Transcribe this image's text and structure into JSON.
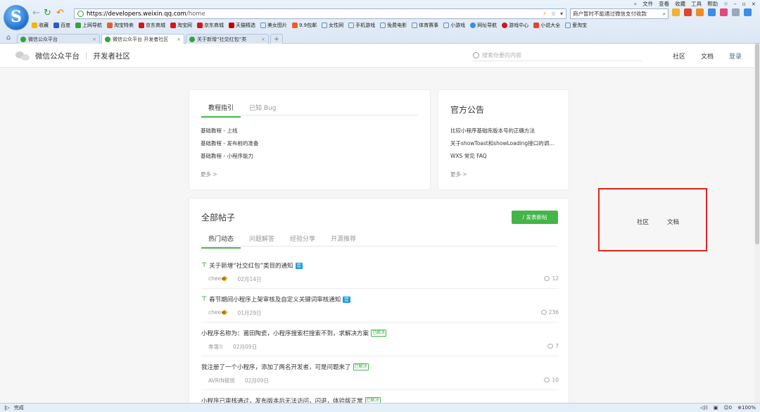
{
  "browser": {
    "menubar": [
      "文件",
      "查看",
      "收藏",
      "工具",
      "帮助"
    ],
    "logo_letter": "S",
    "url_domain": "https://developers.weixin.qq.com",
    "url_path": "/home",
    "search_hint": "商户暂时不能通过微信支付收款",
    "favorites": [
      "收藏",
      "百度",
      "上网导航",
      "淘宝特卖",
      "京东商城",
      "淘宝网",
      "京东商城",
      "天猫精选",
      "美女图片",
      "9.9包邮",
      "女性网",
      "手机游戏",
      "免费电影",
      "体育赛事",
      "小游戏",
      "网址导航",
      "游戏中心",
      "小说大全",
      "爱淘宝"
    ],
    "tabs": [
      {
        "label": "微信公众平台",
        "active": false
      },
      {
        "label": "微信公众平台 开发者社区",
        "active": true
      },
      {
        "label": "关于新增“社交红包”类",
        "active": false
      }
    ],
    "status_text": "完成",
    "zoom": "100%",
    "status_count": "0"
  },
  "header": {
    "brand": "微信公众平台",
    "sub": "开发者社区",
    "search_placeholder": "搜索你要的内容",
    "nav": [
      "社区",
      "文档",
      "登录"
    ]
  },
  "tutorial": {
    "tabs": [
      "教程指引",
      "已知 Bug"
    ],
    "items": [
      "基础教程 - 上线",
      "基础教程 - 发布前的准备",
      "基础教程 - 小程序能力"
    ],
    "more": "更多 >"
  },
  "announce": {
    "title": "官方公告",
    "items": [
      "比较小程序基础库版本号的正确方法",
      "关于showToast和showLoading接口的调...",
      "WXS 常见 FAQ"
    ],
    "more": "更多 >"
  },
  "posts": {
    "title": "全部帖子",
    "new_button": "/ 发表新帖",
    "tabs": [
      "热门动态",
      "问题解答",
      "经验分享",
      "开源推荐"
    ],
    "items": [
      {
        "title": "关于新增“社交红包”类目的通知",
        "pinned": true,
        "official": "官",
        "solved": "",
        "author": "chee🐠",
        "date": "02月14日",
        "count": "12"
      },
      {
        "title": "春节期间小程序上架审核及自定义关键词审核通知",
        "pinned": true,
        "official": "官",
        "solved": "",
        "author": "chee🐠",
        "date": "01月29日",
        "count": "236"
      },
      {
        "title": "小程序名称为：莆田陶瓷，小程序搜索栏搜索不到，求解决方案",
        "pinned": false,
        "official": "",
        "solved": "已解决",
        "author": "零落ℛ",
        "date": "02月09日",
        "count": "7"
      },
      {
        "title": "我注册了一个小程序，添加了两名开发者，可是问题来了",
        "pinned": false,
        "official": "",
        "solved": "已解决",
        "author": "AVRIN筱斑",
        "date": "02月09日",
        "count": "10"
      },
      {
        "title": "小程序已审核通过，发布版本后无法访问，闪退，体验版正常",
        "pinned": false,
        "official": "",
        "solved": "已解决",
        "author": "",
        "date": "",
        "count": ""
      }
    ]
  },
  "overlay": {
    "items": [
      "社区",
      "文档"
    ],
    "border_color": "#e0251c"
  },
  "colors": {
    "accent": "#44b549",
    "link": "#576b95"
  }
}
